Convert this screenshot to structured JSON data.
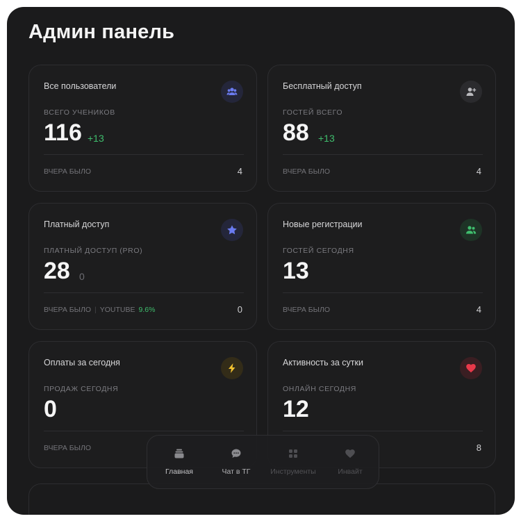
{
  "header": {
    "title": "Админ панель"
  },
  "cards": [
    {
      "title": "Все пользователи",
      "icon": "users-icon",
      "accent": "#6a7bf0",
      "subtitle": "ВСЕГО УЧЕНИКОВ",
      "value": "116",
      "delta": "+13",
      "footer_label": "ВЧЕРА БЫЛО",
      "footer_value": "4"
    },
    {
      "title": "Бесплатный доступ",
      "icon": "user-add-icon",
      "accent": "#b9b9bd",
      "subtitle": "ГОСТЕЙ ВСЕГО",
      "value": "88",
      "delta": "+13",
      "footer_label": "ВЧЕРА БЫЛО",
      "footer_value": "4"
    },
    {
      "title": "Платный доступ",
      "icon": "star-icon",
      "accent": "#6a7bf0",
      "subtitle": "ПЛАТНЫЙ ДОСТУП (PRO)",
      "value": "28",
      "delta": "0",
      "footer_label": "ВЧЕРА БЫЛО",
      "footer_extra": "YOUTUBE",
      "footer_extra_value": "9.6%",
      "footer_value": "0"
    },
    {
      "title": "Новые регистрации",
      "icon": "users-green-icon",
      "accent": "#3fbd6d",
      "subtitle": "ГОСТЕЙ СЕГОДНЯ",
      "value": "13",
      "footer_label": "ВЧЕРА БЫЛО",
      "footer_value": "4"
    },
    {
      "title": "Оплаты за сегодня",
      "icon": "lightning-icon",
      "accent": "#f2c230",
      "subtitle": "ПРОДАЖ СЕГОДНЯ",
      "value": "0",
      "footer_label": "ВЧЕРА БЫЛО"
    },
    {
      "title": "Активность за сутки",
      "icon": "heart-icon",
      "accent": "#e8394a",
      "subtitle": "ОНЛАЙН СЕГОДНЯ",
      "value": "12",
      "footer_value": "8"
    }
  ],
  "tabbar": {
    "items": [
      {
        "label": "Главная",
        "icon": "home-stack-icon",
        "state": "active"
      },
      {
        "label": "Чат в ТГ",
        "icon": "chat-bubble-icon",
        "state": "normal"
      },
      {
        "label": "Инструменты",
        "icon": "grid-icon",
        "state": "dim"
      },
      {
        "label": "Инвайт",
        "icon": "heart-outline-icon",
        "state": "dim"
      }
    ]
  }
}
